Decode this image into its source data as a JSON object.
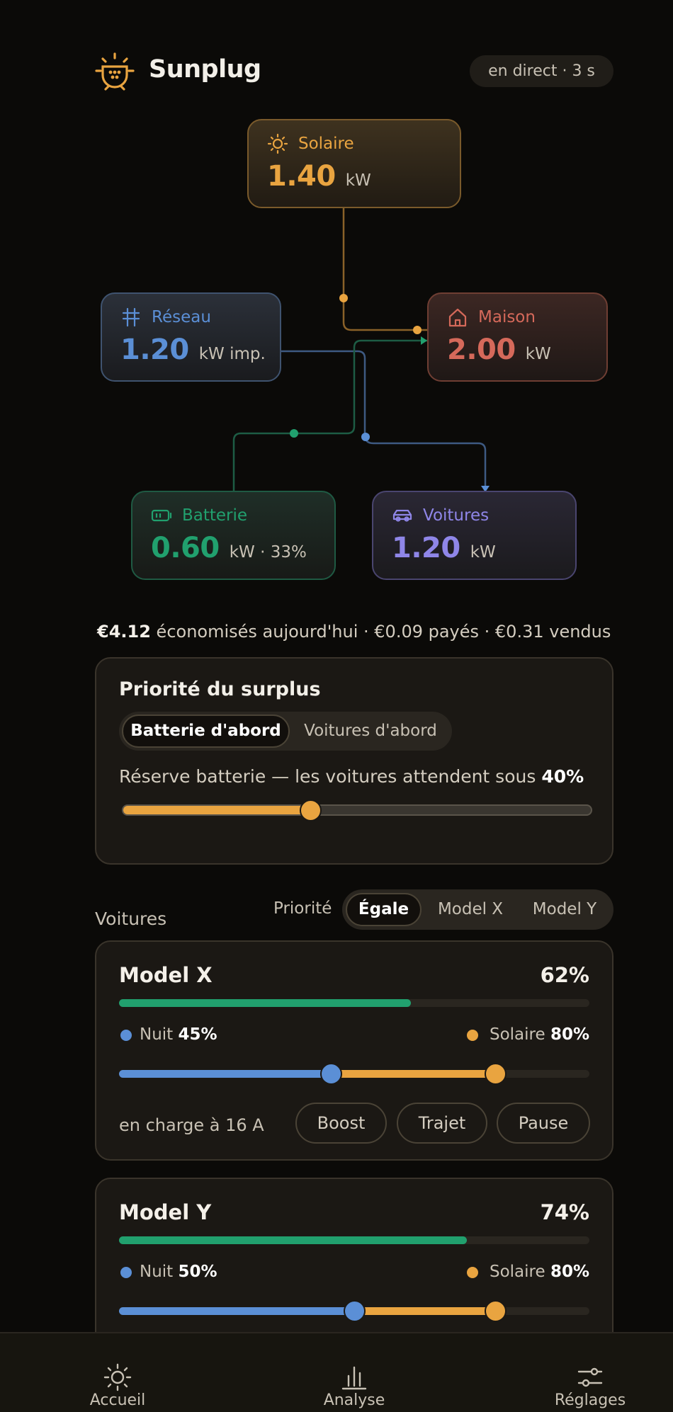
{
  "header": {
    "title": "Sunplug",
    "live_badge": "en direct · 3 s"
  },
  "flow": {
    "solar": {
      "label": "Solaire",
      "value": "1.40",
      "unit": "kW"
    },
    "grid": {
      "label": "Réseau",
      "value": "1.20",
      "unit": "kW imp."
    },
    "home": {
      "label": "Maison",
      "value": "2.00",
      "unit": "kW"
    },
    "battery": {
      "label": "Batterie",
      "value": "0.60",
      "unit": "kW · 33%"
    },
    "cars": {
      "label": "Voitures",
      "value": "1.20",
      "unit": "kW"
    }
  },
  "savings": {
    "amount": "€4.12",
    "text": " économisés aujourd'hui · €0.09 payés · €0.31 vendus"
  },
  "surplus": {
    "title": "Priorité du surplus",
    "options": [
      "Batterie d'abord",
      "Voitures d'abord"
    ],
    "selected": "Batterie d'abord",
    "reserve_text": "Réserve batterie — les voitures attendent sous ",
    "reserve_value": "40%",
    "reserve_level": 0.4
  },
  "cars_section": {
    "label": "Voitures",
    "priority_label": "Priorité",
    "priority_options": [
      "Égale",
      "Model X",
      "Model Y"
    ],
    "priority_selected": "Égale"
  },
  "cars": [
    {
      "name": "Model X",
      "soc": "62%",
      "soc_level": 0.62,
      "night_label": "Nuit",
      "night_value": "45%",
      "night_level": 0.45,
      "solar_label": "Solaire",
      "solar_value": "80%",
      "solar_level": 0.8,
      "status": "en charge à 16 A",
      "actions": [
        "Boost",
        "Trajet",
        "Pause"
      ]
    },
    {
      "name": "Model Y",
      "soc": "74%",
      "soc_level": 0.74,
      "night_label": "Nuit",
      "night_value": "50%",
      "night_level": 0.5,
      "solar_label": "Solaire",
      "solar_value": "80%",
      "solar_level": 0.8
    }
  ],
  "nav": [
    {
      "label": "Accueil",
      "icon": "sun-icon"
    },
    {
      "label": "Analyse",
      "icon": "bar-chart-icon"
    },
    {
      "label": "Réglages",
      "icon": "sliders-icon"
    }
  ],
  "colors": {
    "solar": "#e9a440",
    "grid": "#5b8fd6",
    "home": "#d5695a",
    "battery": "#21a06e",
    "cars": "#8f86e8",
    "background": "#0b0a08"
  }
}
